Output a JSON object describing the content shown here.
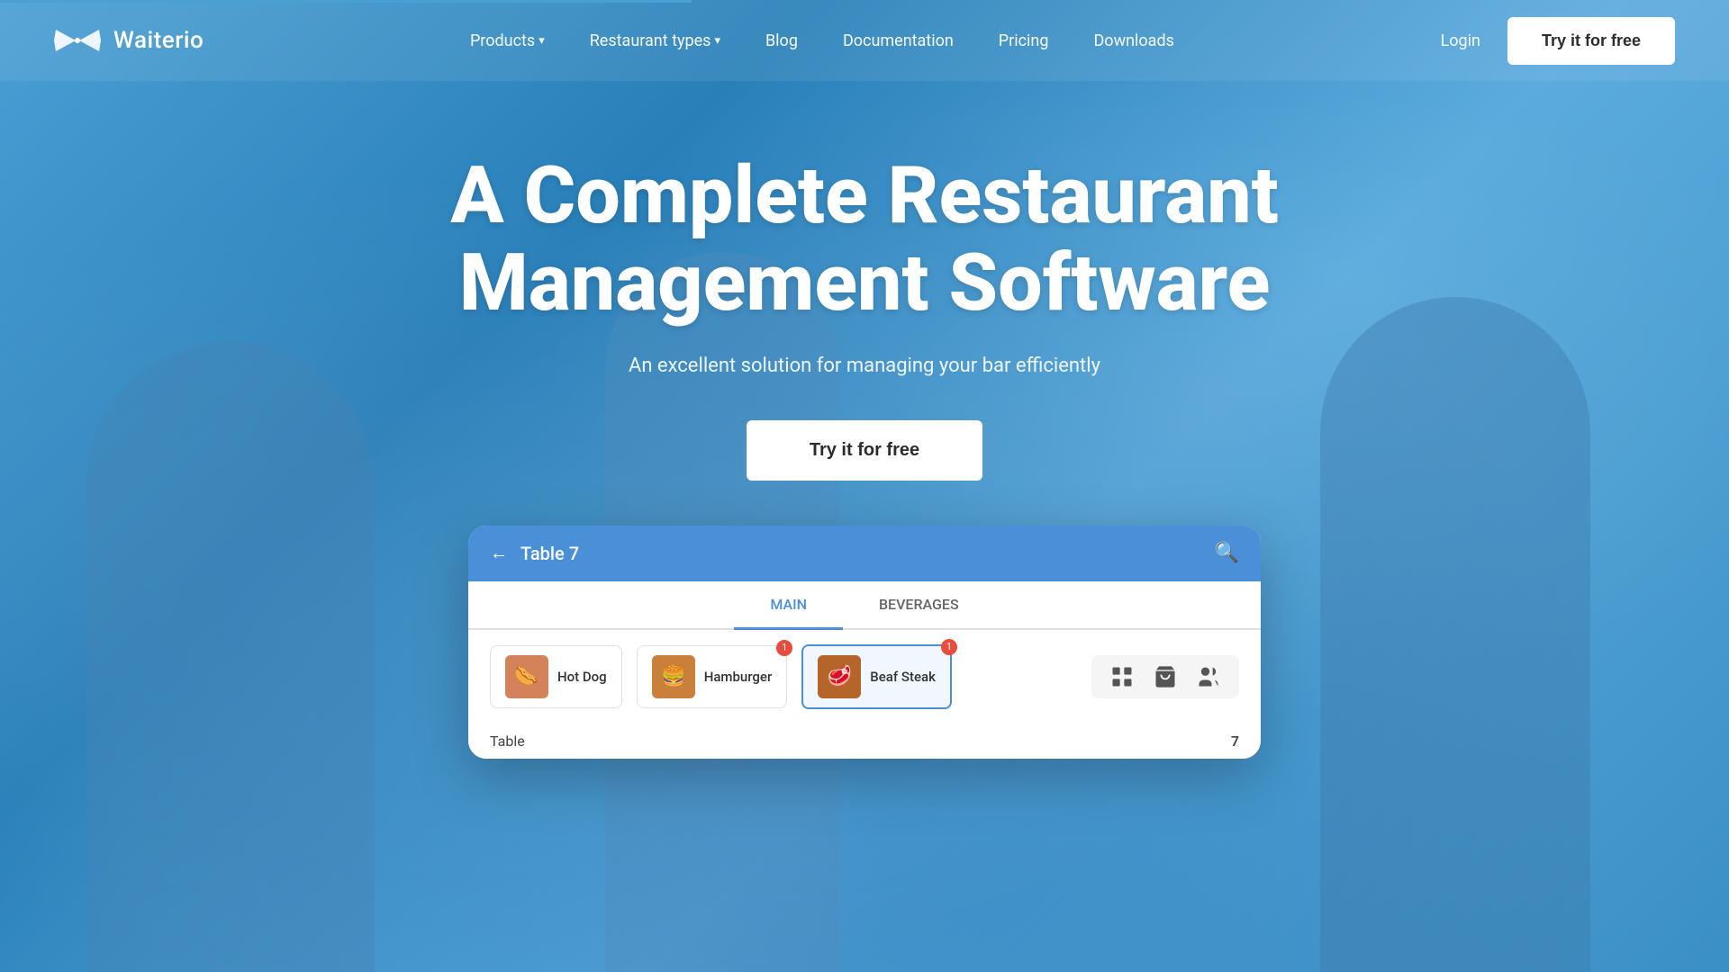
{
  "brand": {
    "logo_alt": "Waiterio bow-tie logo",
    "name": "Waiterio"
  },
  "navbar": {
    "links": [
      {
        "id": "products",
        "label": "Products",
        "has_dropdown": true
      },
      {
        "id": "restaurant-types",
        "label": "Restaurant types",
        "has_dropdown": true
      },
      {
        "id": "blog",
        "label": "Blog",
        "has_dropdown": false
      },
      {
        "id": "documentation",
        "label": "Documentation",
        "has_dropdown": false
      },
      {
        "id": "pricing",
        "label": "Pricing",
        "has_dropdown": false
      },
      {
        "id": "downloads",
        "label": "Downloads",
        "has_dropdown": false
      }
    ],
    "login_label": "Login",
    "cta_label": "Try it for free"
  },
  "hero": {
    "title_line1": "A Complete Restaurant",
    "title_line2": "Management Software",
    "subtitle": "An excellent solution for managing your bar efficiently",
    "cta_label": "Try it for free"
  },
  "app_preview": {
    "bar_title": "Table 7",
    "tab_main": "MAIN",
    "tab_beverages": "BEVERAGES",
    "menu_items": [
      {
        "id": "hot-dog",
        "name": "Hot Dog",
        "emoji": "🌭",
        "selected": false
      },
      {
        "id": "hamburger",
        "name": "Hamburger",
        "emoji": "🍔",
        "badge": "1",
        "selected": false
      },
      {
        "id": "beef-steak",
        "name": "Beaf Steak",
        "emoji": "🥩",
        "badge": "1",
        "selected": true
      }
    ],
    "order_label": "Table",
    "order_count": "7"
  }
}
